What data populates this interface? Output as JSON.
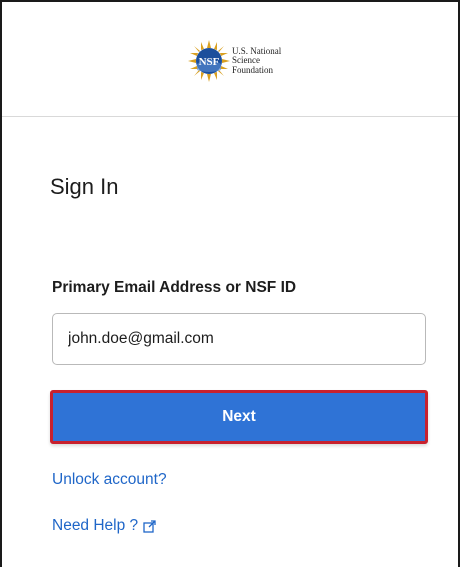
{
  "brand": {
    "logo_seal_text": "NSF",
    "line1": "U.S. National",
    "line2": "Science",
    "line3": "Foundation"
  },
  "form": {
    "title": "Sign In",
    "email_label": "Primary Email Address or NSF ID",
    "email_value": "john.doe@gmail.com",
    "next_label": "Next"
  },
  "links": {
    "unlock": "Unlock account?",
    "help": "Need Help ?"
  },
  "colors": {
    "primary_button": "#2f73d6",
    "button_outline": "#c8212e",
    "link": "#1f66c8"
  },
  "icons": {
    "help_link_icon": "external-link-icon"
  }
}
